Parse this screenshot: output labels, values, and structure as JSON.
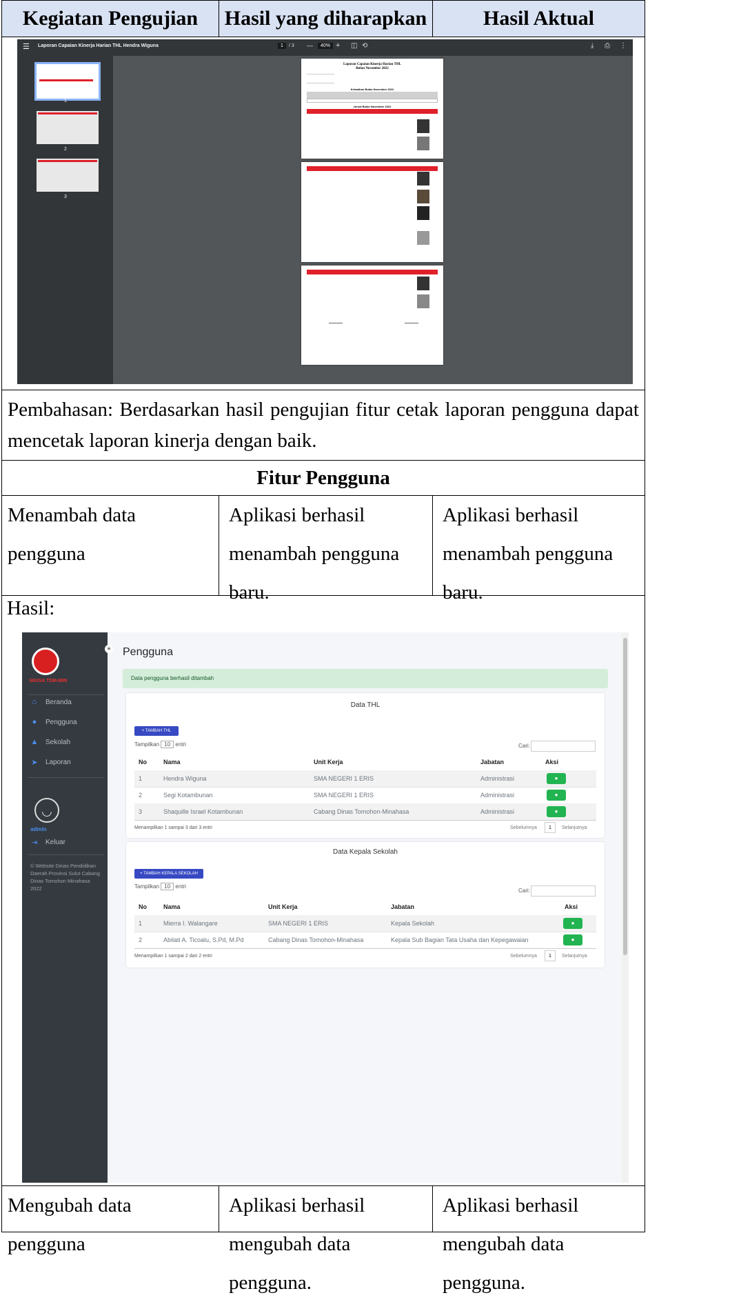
{
  "table_header": {
    "col1": "Kegiatan Pengujian",
    "col2": "Hasil yang diharapkan",
    "col3": "Hasil Aktual"
  },
  "pdf_viewer": {
    "title": "Laporan Capaian Kinerja Harian THL Hendra Wiguna",
    "page_current": "1",
    "page_total": "/ 3",
    "zoom": "40%",
    "thumbnails": [
      "1",
      "2",
      "3"
    ],
    "report_title": "Laporan Capaian Kinerja Harian THL",
    "report_subtitle": "Bulan November 2022",
    "attendance_heading": "Kehadiran Bulan November 2022",
    "schedule_heading": "Jurnal Bulan November 2022"
  },
  "discussion": "Pembahasan: Berdasarkan hasil pengujian fitur cetak laporan pengguna dapat mencetak laporan kinerja dengan baik.",
  "section_title": "Fitur Pengguna",
  "row_add": {
    "col1": "Menambah data pengguna",
    "col2": "Aplikasi berhasil menambah pengguna baru.",
    "col3": "Aplikasi berhasil menambah pengguna baru."
  },
  "hasil_label": "Hasil:",
  "app": {
    "brand": "SIKISA TDM-MIN",
    "menu": [
      "Beranda",
      "Pengguna",
      "Sekolah",
      "Laporan"
    ],
    "user": "admin",
    "logout": "Keluar",
    "footer": "© Website Dinas Pendidikan Daerah Provinsi Sulut Cabang Dinas Tomohon Minahasa 2022",
    "page_title": "Pengguna",
    "alert": "Data pengguna berhasil ditambah",
    "thl": {
      "title": "Data THL",
      "add_button": "+ TAMBAH THL",
      "show_prefix": "Tampilkan",
      "show_value": "10",
      "show_suffix": "entri",
      "search_label": "Cari:",
      "columns": [
        "No",
        "Nama",
        "Unit Kerja",
        "Jabatan",
        "Aksi"
      ],
      "rows": [
        [
          "1",
          "Hendra Wiguna",
          "SMA NEGERI 1 ERIS",
          "Administrasi"
        ],
        [
          "2",
          "Segi Kotambunan",
          "SMA NEGERI 1 ERIS",
          "Administrasi"
        ],
        [
          "3",
          "Shaquille Israel Kotambunan",
          "Cabang Dinas Tomohon-Minahasa",
          "Administrasi"
        ]
      ],
      "info": "Menampilkan 1 sampai 3 dari 3 entri",
      "prev": "Sebelumnya",
      "page": "1",
      "next": "Selanjutnya"
    },
    "kepsek": {
      "title": "Data Kepala Sekolah",
      "add_button": "+ TAMBAH KEPALA SEKOLAH",
      "show_prefix": "Tampilkan",
      "show_value": "10",
      "show_suffix": "entri",
      "search_label": "Cari:",
      "columns": [
        "No",
        "Nama",
        "Unit Kerja",
        "Jabatan",
        "Aksi"
      ],
      "rows": [
        [
          "1",
          "Mierra I. Walangare",
          "SMA NEGERI 1 ERIS",
          "Kepala Sekolah"
        ],
        [
          "2",
          "Abilati A. Ticoalu, S.Pd, M.Pd",
          "Cabang Dinas Tomohon-Minahasa",
          "Kepala Sub Bagian Tata Usaha dan Kepegawaian"
        ]
      ],
      "info": "Menampilkan 1 sampai 2 dari 2 entri",
      "prev": "Sebelumnya",
      "page": "1",
      "next": "Selanjutnya"
    }
  },
  "row_edit": {
    "col1": "Mengubah data pengguna",
    "col2": "Aplikasi berhasil mengubah data pengguna.",
    "col3": "Aplikasi berhasil mengubah data pengguna."
  }
}
